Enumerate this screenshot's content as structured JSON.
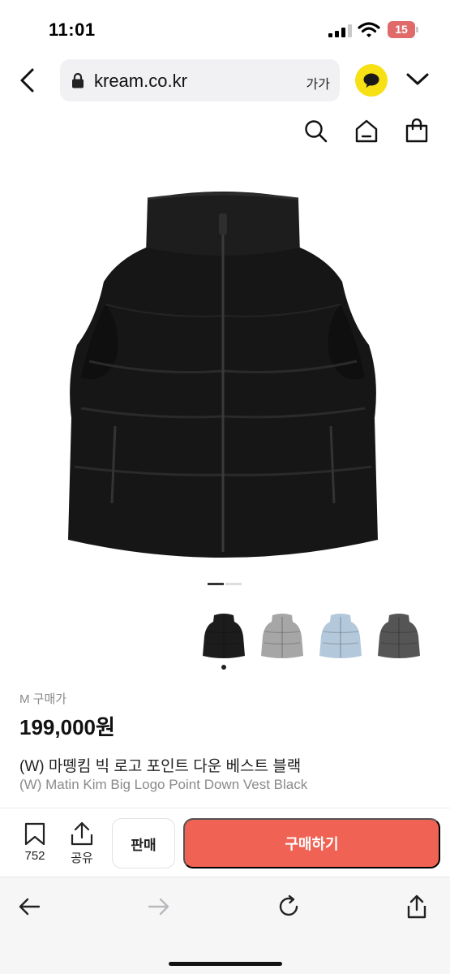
{
  "status_bar": {
    "time": "11:01",
    "battery": "15",
    "battery_color": "#e06a6a"
  },
  "browser": {
    "url": "kream.co.kr",
    "text_size_label": "가가",
    "icons": [
      "back-chevron-icon",
      "lock-icon",
      "kakao-chat-icon",
      "chevron-down-icon"
    ]
  },
  "site_header": {
    "icons": [
      "search-icon",
      "home-icon",
      "shopping-bag-icon"
    ]
  },
  "product": {
    "size_label": "M 구매가",
    "price": "199,000원",
    "name_ko": "(W) 마뗑킴 빅 로고 포인트 다운 베스트 블랙",
    "name_en": "(W) Matin Kim Big Logo Point Down Vest Black",
    "image_count": 2,
    "current_image": 1,
    "variants": [
      {
        "color_name": "black",
        "color": "#1c1c1c",
        "selected": true
      },
      {
        "color_name": "silver",
        "color": "#a6a6a6",
        "selected": false
      },
      {
        "color_name": "light blue",
        "color": "#b3c8db",
        "selected": false
      },
      {
        "color_name": "charcoal",
        "color": "#555555",
        "selected": false
      }
    ]
  },
  "actions": {
    "wish_count": "752",
    "share_label": "공유",
    "sell_label": "판매",
    "buy_label": "구매하기",
    "buy_color": "#ef6254"
  },
  "toolbar": {
    "icons": [
      "back-arrow-icon",
      "forward-arrow-icon",
      "reload-icon",
      "share-icon"
    ]
  }
}
